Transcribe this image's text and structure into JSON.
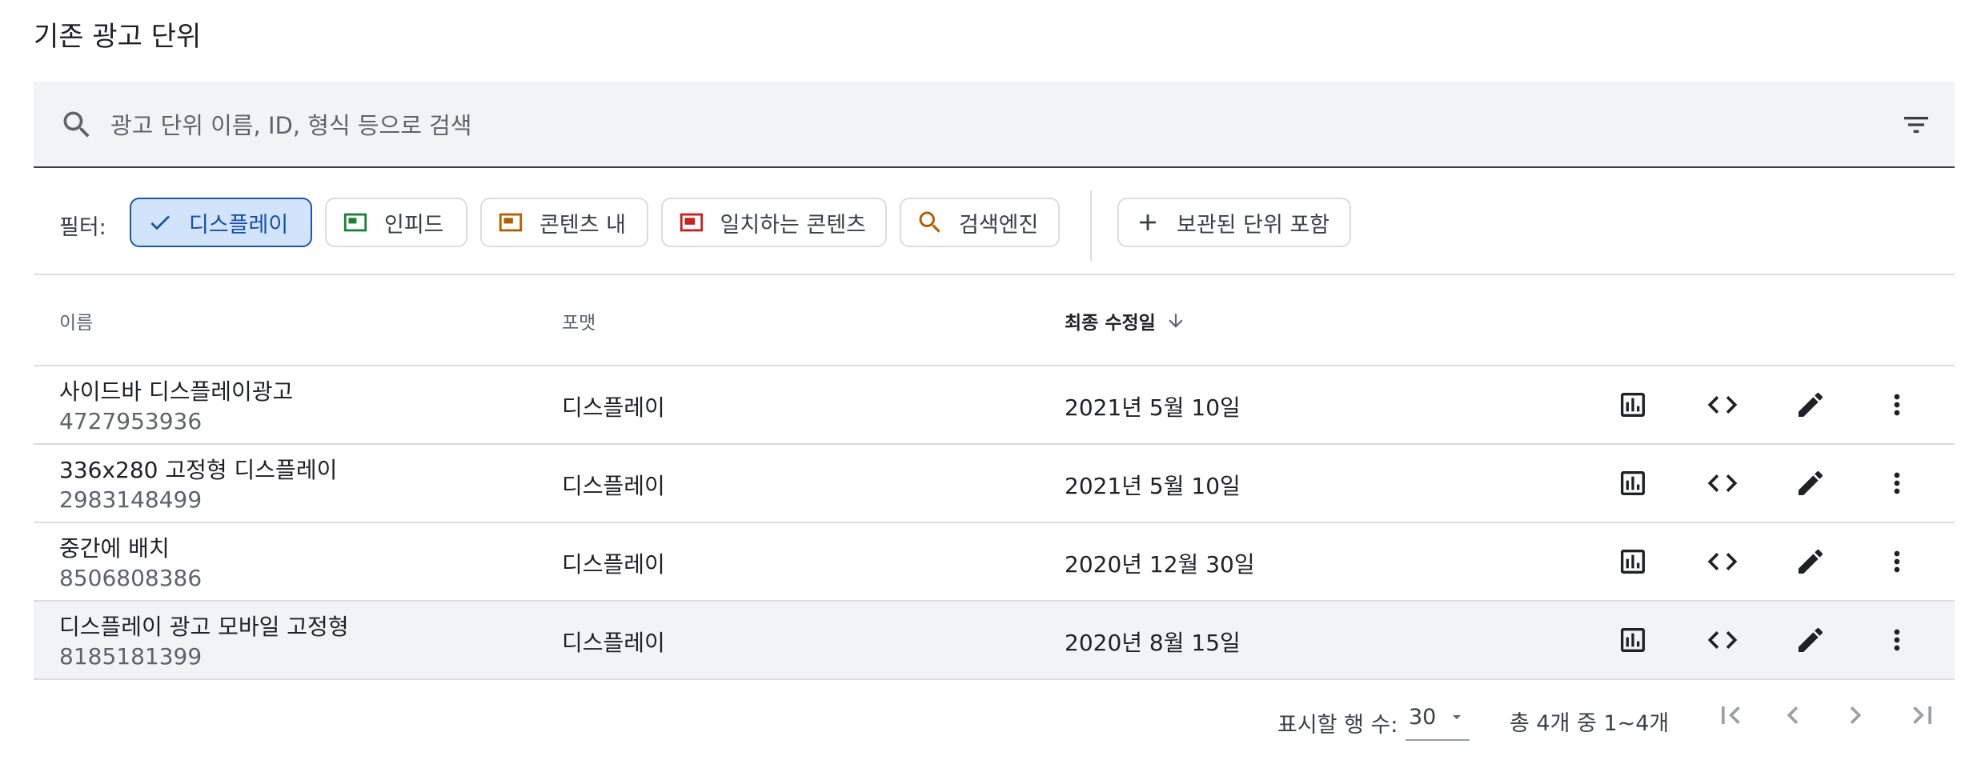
{
  "page": {
    "title": "기존 광고 단위"
  },
  "search": {
    "placeholder": "광고 단위 이름, ID, 형식 등으로 검색",
    "value": ""
  },
  "filters": {
    "label": "필터:",
    "chips": [
      {
        "label": "디스플레이",
        "selected": true,
        "icon": "check-icon"
      },
      {
        "label": "인피드",
        "selected": false,
        "icon": "infeed-ad-icon",
        "color": "#188038"
      },
      {
        "label": "콘텐츠 내",
        "selected": false,
        "icon": "in-article-ad-icon",
        "color": "#b06000"
      },
      {
        "label": "일치하는 콘텐츠",
        "selected": false,
        "icon": "matched-content-icon",
        "color": "#c5221f"
      },
      {
        "label": "검색엔진",
        "selected": false,
        "icon": "search-icon",
        "color": "#b06000"
      }
    ],
    "archived": {
      "label": "보관된 단위 포함",
      "icon": "add-icon"
    }
  },
  "table": {
    "columns": {
      "name": "이름",
      "format": "포맷",
      "modified": "최종 수정일"
    },
    "sort": {
      "column": "modified",
      "direction": "descending"
    },
    "rows": [
      {
        "name": "사이드바 디스플레이광고",
        "id": "4727953936",
        "format": "디스플레이",
        "modified": "2021년 5월 10일",
        "highlighted": false
      },
      {
        "name": "336x280 고정형 디스플레이",
        "id": "2983148499",
        "format": "디스플레이",
        "modified": "2021년 5월 10일",
        "highlighted": false
      },
      {
        "name": "중간에 배치",
        "id": "8506808386",
        "format": "디스플레이",
        "modified": "2020년 12월 30일",
        "highlighted": false
      },
      {
        "name": "디스플레이 광고 모바일 고정형",
        "id": "8185181399",
        "format": "디스플레이",
        "modified": "2020년 8월 15일",
        "highlighted": true
      }
    ],
    "row_actions": [
      "report-icon",
      "code-icon",
      "edit-icon",
      "more-vert-icon"
    ]
  },
  "pagination": {
    "rows_label": "표시할 행 수:",
    "rows_value": "30",
    "range_text": "총 4개 중 1~4개"
  },
  "colors": {
    "accent": "#1a56b8",
    "selected_chip_bg": "#d2e3fc",
    "text": "#202124",
    "muted": "#5f6368"
  }
}
